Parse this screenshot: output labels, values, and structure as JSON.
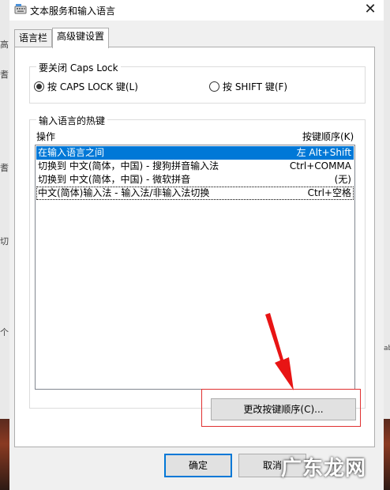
{
  "window": {
    "title": "文本服务和输入语言",
    "close_glyph": "✕"
  },
  "tabs": [
    {
      "label": "语言栏"
    },
    {
      "label": "高级键设置"
    }
  ],
  "caps_lock": {
    "legend": "要关闭 Caps Lock",
    "options": [
      {
        "label": "按 CAPS LOCK 键(L)",
        "selected": true
      },
      {
        "label": "按 SHIFT 键(F)",
        "selected": false
      }
    ]
  },
  "hotkeys": {
    "legend": "输入语言的热键",
    "col_action": "操作",
    "col_key": "按键顺序(K)",
    "rows": [
      {
        "action": "在输入语言之间",
        "key": "左 Alt+Shift",
        "selected": true
      },
      {
        "action": "切换到 中文(简体，中国) - 搜狗拼音输入法",
        "key": "Ctrl+COMMA",
        "selected": false
      },
      {
        "action": "切换到 中文(简体，中国) - 微软拼音",
        "key": "(无)",
        "selected": false
      },
      {
        "action": "中文(简体)输入法 - 输入法/非输入法切换",
        "key": "Ctrl+空格",
        "selected": false
      }
    ],
    "change_button": "更改按键顺序(C)..."
  },
  "footer": {
    "ok": "确定",
    "cancel": "取消"
  },
  "background_fragments": [
    "高",
    "耆",
    "耆",
    "切",
    "个",
    "ab"
  ],
  "watermark": "广东龙网",
  "colors": {
    "selection": "#0078d7",
    "highlight": "#e03030"
  }
}
